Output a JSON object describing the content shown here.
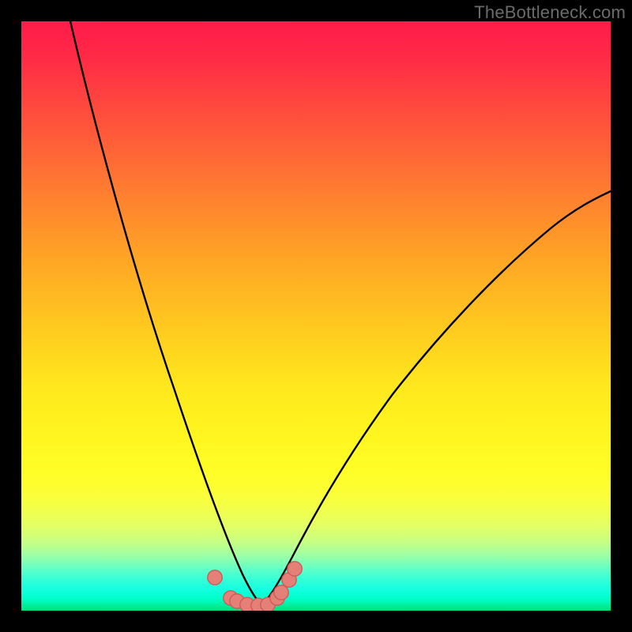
{
  "watermark": "TheBottleneck.com",
  "colors": {
    "frame": "#000000",
    "curve": "#000000",
    "marker_fill": "#e58079",
    "marker_stroke": "#cf5a56",
    "gradient_top": "#ff1b4a",
    "gradient_bottom": "#00e07a"
  },
  "chart_data": {
    "type": "line",
    "title": "",
    "xlabel": "",
    "ylabel": "",
    "xlim": [
      0,
      100
    ],
    "ylim": [
      0,
      100
    ],
    "grid": false,
    "legend": false,
    "series": [
      {
        "name": "left-branch",
        "x": [
          8,
          10,
          13,
          16,
          19,
          22,
          25,
          28,
          30,
          32,
          34,
          35.5,
          37,
          38.5,
          40
        ],
        "y": [
          100,
          90,
          78,
          67,
          56,
          45.5,
          35,
          25.5,
          19,
          13.5,
          9,
          6,
          3.8,
          2.2,
          1.2
        ]
      },
      {
        "name": "right-branch",
        "x": [
          40,
          42,
          44,
          47,
          50,
          54,
          58,
          63,
          68,
          74,
          80,
          86,
          92,
          99
        ],
        "y": [
          1.2,
          2.8,
          5.6,
          10.5,
          16,
          22.5,
          29,
          36,
          42.5,
          49,
          55,
          60.5,
          65.5,
          71
        ]
      }
    ],
    "markers": {
      "name": "bottom-dots",
      "x": [
        32.9,
        35.5,
        36.6,
        38.4,
        40.2,
        41.8,
        43.4,
        44.1,
        45.5,
        46.4
      ],
      "y": [
        5.6,
        2.2,
        1.6,
        1.0,
        0.9,
        1.0,
        2.1,
        3.0,
        5.2,
        7.1
      ]
    }
  }
}
